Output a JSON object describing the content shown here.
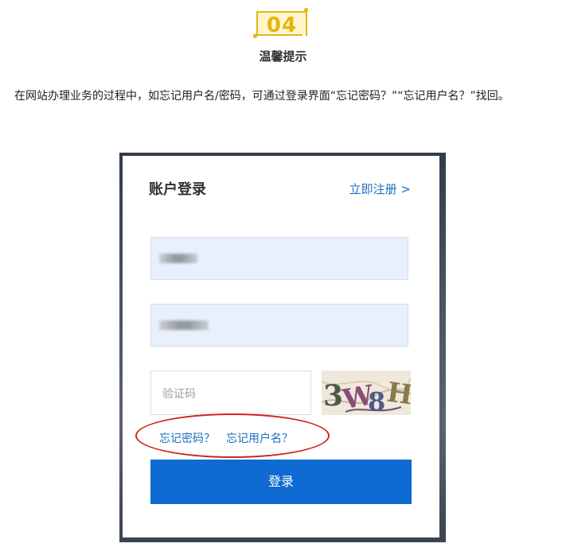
{
  "badge": {
    "number": "04"
  },
  "section": {
    "title": "温馨提示"
  },
  "paragraph": {
    "text": "在网站办理业务的过程中，如忘记用户名/密码，可通过登录界面“忘记密码？”“忘记用户名？”找回。"
  },
  "login": {
    "title": "账户登录",
    "register_link": "立即注册 >",
    "username_field": {
      "value": ""
    },
    "password_field": {
      "value": ""
    },
    "captcha_placeholder": "验证码",
    "captcha_text": "3W8H",
    "forgot_password": "忘记密码？",
    "forgot_username": "忘记用户名？",
    "submit_label": "登录"
  },
  "colors": {
    "accent_gold": "#e6b412",
    "link_blue": "#1a6fc0",
    "button_blue": "#0f6bd2",
    "highlight_red": "#d0241b",
    "field_fill": "#e8f0fe"
  },
  "icons": {
    "captcha": "captcha-image"
  }
}
